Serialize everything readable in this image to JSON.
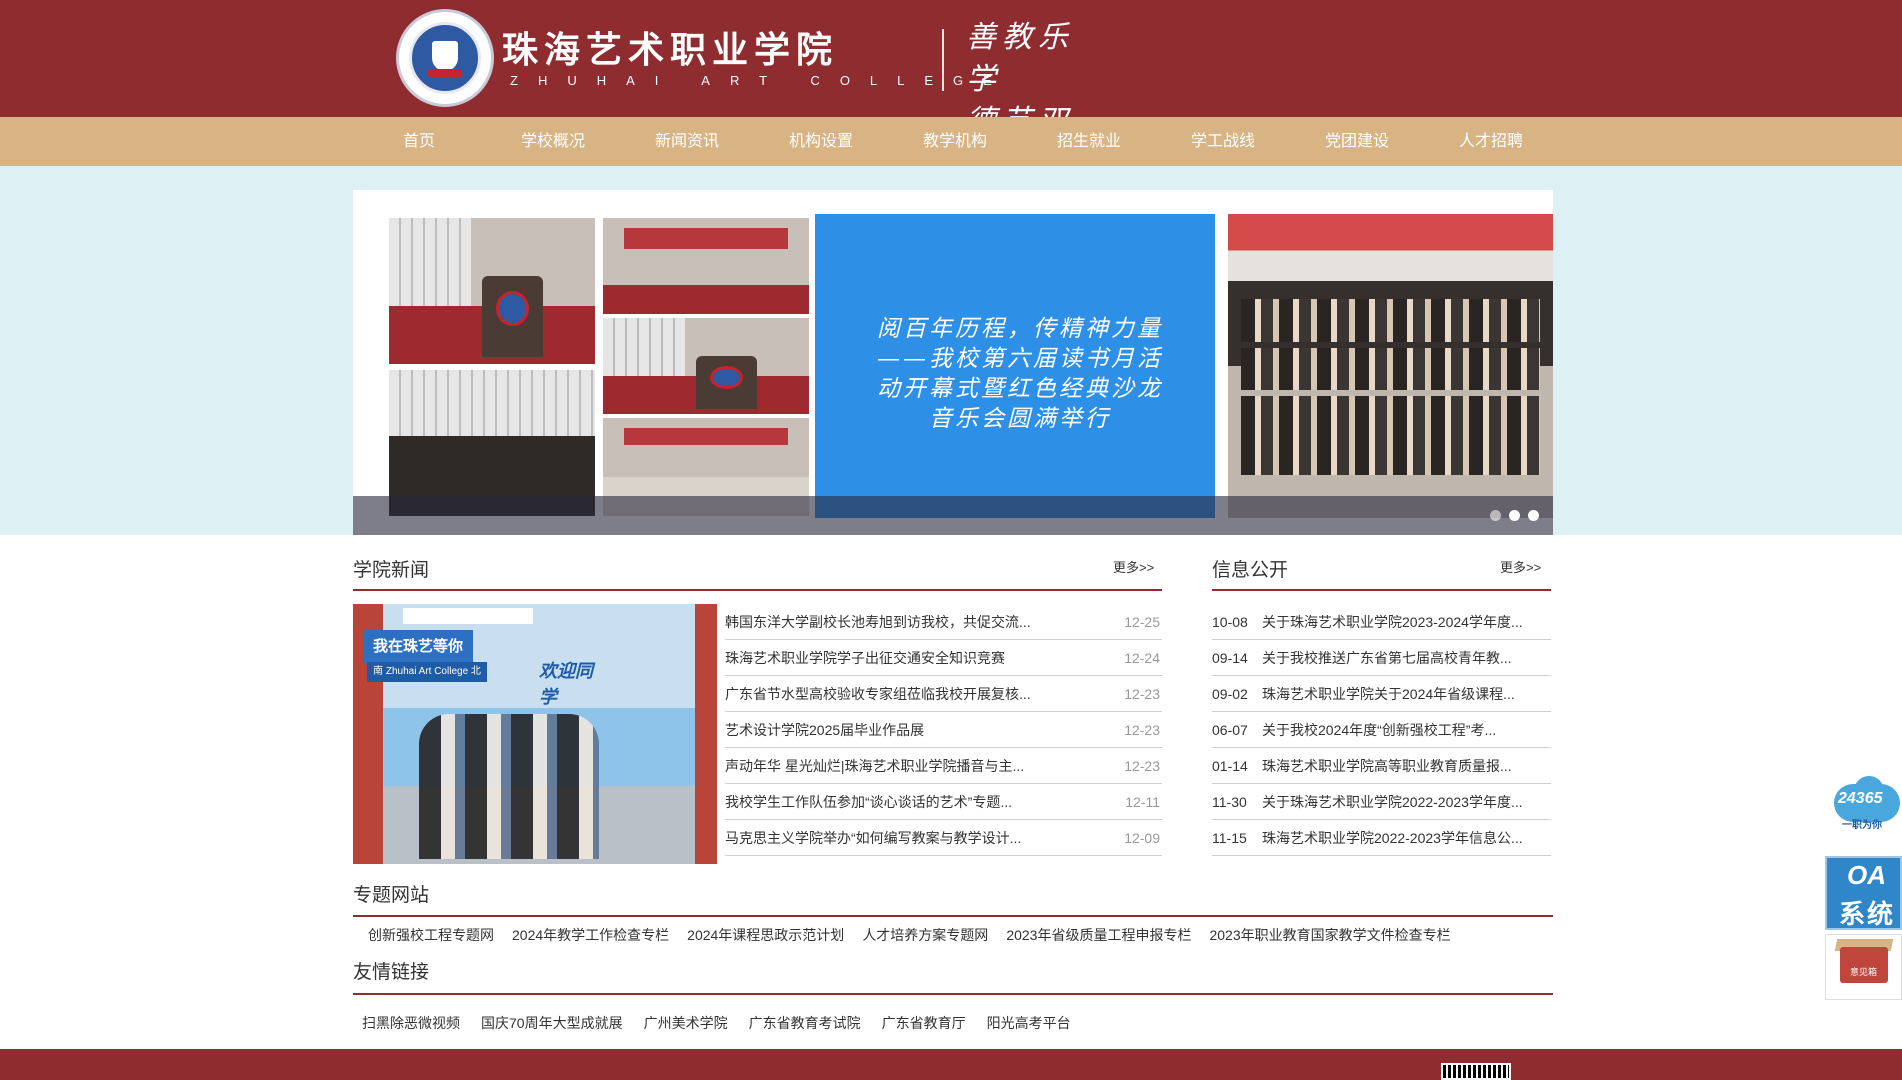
{
  "header": {
    "school_name": "珠海艺术职业学院",
    "school_name_en": "ZHUHAI ART COLLEGE",
    "motto_line1": "善教乐学",
    "motto_line2": "德艺双馨",
    "emblem_text": "ZHUHAI ART COLLEGE"
  },
  "nav": {
    "items": [
      "首页",
      "学校概况",
      "新闻资讯",
      "机构设置",
      "教学机构",
      "招生就业",
      "学工战线",
      "党团建设",
      "人才招聘"
    ]
  },
  "slider": {
    "slide_title": "阅百年历程，传精神力量——我校第六届读书月活动开幕式暨红色经典沙龙音乐会圆满举行",
    "active_dot": 2,
    "dot_count": 3
  },
  "news_section": {
    "title": "学院新闻",
    "more": "更多>>",
    "photo_sign": "我在珠艺等你",
    "photo_board": "南  Zhuhai Art College  北",
    "photo_welcome": "欢迎同学",
    "items": [
      {
        "title": "韩国东洋大学副校长池寿旭到访我校，共促交流...",
        "date": "12-25"
      },
      {
        "title": "珠海艺术职业学院学子出征交通安全知识竞赛",
        "date": "12-24"
      },
      {
        "title": "广东省节水型高校验收专家组莅临我校开展复核...",
        "date": "12-23"
      },
      {
        "title": "艺术设计学院2025届毕业作品展",
        "date": "12-23"
      },
      {
        "title": "声动年华 星光灿烂|珠海艺术职业学院播音与主...",
        "date": "12-23"
      },
      {
        "title": "我校学生工作队伍参加“谈心谈话的艺术”专题...",
        "date": "12-11"
      },
      {
        "title": "马克思主义学院举办“如何编写教案与教学设计...",
        "date": "12-09"
      }
    ]
  },
  "info_section": {
    "title": "信息公开",
    "more": "更多>>",
    "items": [
      {
        "date": "10-08",
        "title": "关于珠海艺术职业学院2023-2024学年度..."
      },
      {
        "date": "09-14",
        "title": "关于我校推送广东省第七届高校青年教..."
      },
      {
        "date": "09-02",
        "title": "珠海艺术职业学院关于2024年省级课程..."
      },
      {
        "date": "06-07",
        "title": "关于我校2024年度“创新强校工程”考..."
      },
      {
        "date": "01-14",
        "title": "珠海艺术职业学院高等职业教育质量报..."
      },
      {
        "date": "11-30",
        "title": "关于珠海艺术职业学院2022-2023学年度..."
      },
      {
        "date": "11-15",
        "title": "珠海艺术职业学院2022-2023学年信息公..."
      }
    ]
  },
  "topics": {
    "title": "专题网站",
    "links": [
      "创新强校工程专题网",
      "2024年教学工作检查专栏",
      "2024年课程思政示范计划",
      "人才培养方案专题网",
      "2023年省级质量工程申报专栏",
      "2023年职业教育国家教学文件检查专栏"
    ]
  },
  "friends": {
    "title": "友情链接",
    "links": [
      "扫黑除恶微视频",
      "国庆70周年大型成就展",
      "广州美术学院",
      "广东省教育考试院",
      "广东省教育厅",
      "阳光高考平台"
    ]
  },
  "floating": {
    "service_num": "24365",
    "service_sub": "一职为你",
    "oa_top": "OA",
    "oa_bottom": "系统",
    "feedback": "意见箱"
  },
  "colors": {
    "brand": "#8e2c30",
    "nav": "#d8b485",
    "band": "#ddf0f3",
    "slide_blue": "#2e8fe6"
  }
}
